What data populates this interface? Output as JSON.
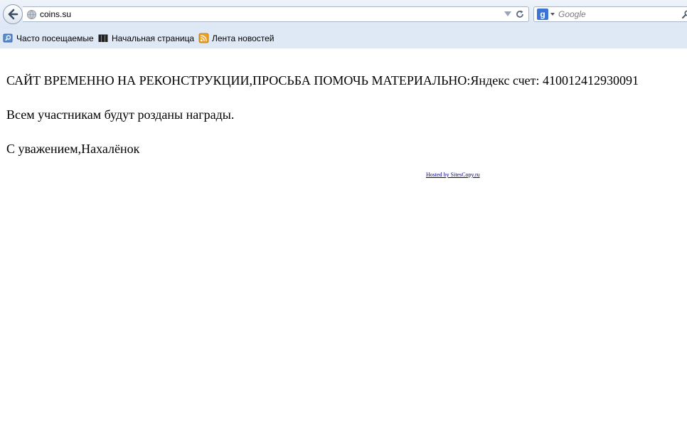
{
  "browser": {
    "address_bar": {
      "url": "coins.su"
    },
    "search_bar": {
      "engine_icon_letter": "g",
      "placeholder": "Google"
    },
    "bookmarks": [
      {
        "label": "Часто посещаемые",
        "icon": "search-folder-icon"
      },
      {
        "label": "Начальная страница",
        "icon": "m-logo-icon"
      },
      {
        "label": "Лента новостей",
        "icon": "rss-feed-icon"
      }
    ]
  },
  "page": {
    "lines": [
      "САЙТ ВРЕМЕННО НА РЕКОНСТРУКЦИИ,ПРОСЬБА ПОМОЧЬ МАТЕРИАЛЬНО:Яндекс счет: 410012412930091",
      "Всем участникам будут розданы награды.",
      "С уважением,Нахалёнок"
    ],
    "hosted_link": "Hosted by SitesCopy.ru"
  },
  "colors": {
    "link": "#00007f",
    "toolbar_bg": "#dfe9f6",
    "google_blue": "#3a74d6",
    "rss_orange": "#f0a020"
  }
}
